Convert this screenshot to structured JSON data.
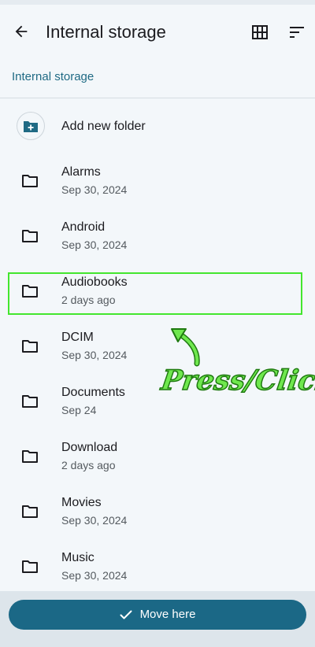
{
  "appbar": {
    "title": "Internal storage",
    "icons": [
      "back-arrow-icon",
      "grid-view-icon",
      "sort-icon"
    ]
  },
  "breadcrumb": {
    "label": "Internal storage"
  },
  "list": {
    "add_folder_label": "Add new folder",
    "folders": [
      {
        "name": "Alarms",
        "date": "Sep 30, 2024"
      },
      {
        "name": "Android",
        "date": "Sep 30, 2024"
      },
      {
        "name": "Audiobooks",
        "date": "2 days ago"
      },
      {
        "name": "DCIM",
        "date": "Sep 30, 2024"
      },
      {
        "name": "Documents",
        "date": "Sep 24"
      },
      {
        "name": "Download",
        "date": "2 days ago"
      },
      {
        "name": "Movies",
        "date": "Sep 30, 2024"
      },
      {
        "name": "Music",
        "date": "Sep 30, 2024"
      }
    ]
  },
  "annotation": {
    "text": "Press/Click",
    "color": "#43e62e"
  },
  "bottom": {
    "move_label": "Move here",
    "button_color": "#1b6886"
  }
}
